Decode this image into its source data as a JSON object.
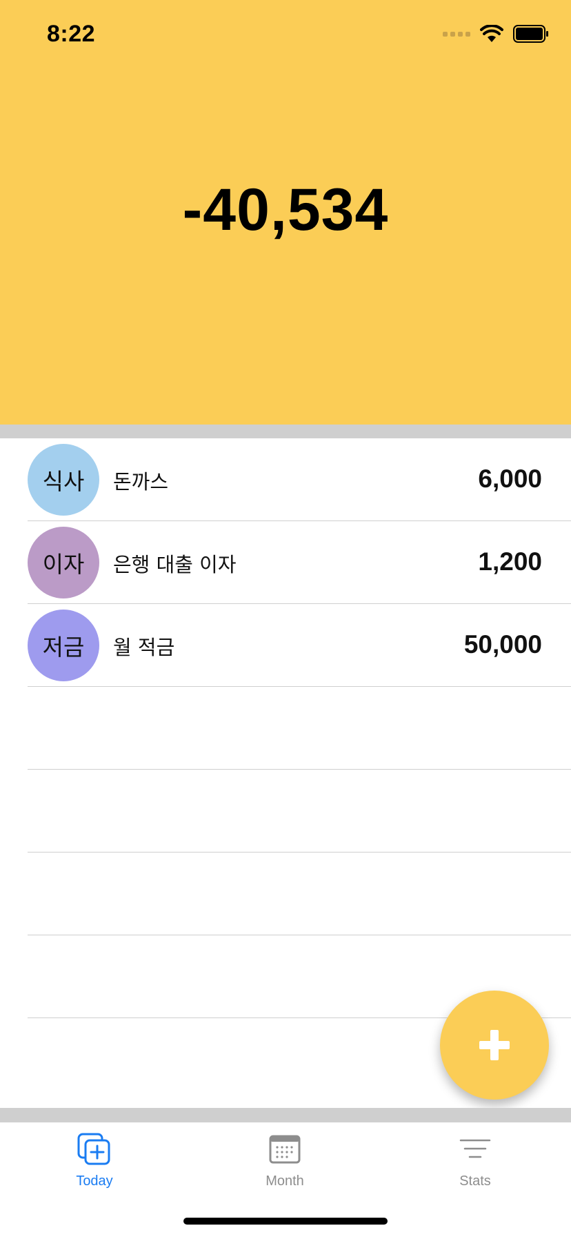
{
  "status_bar": {
    "time": "8:22"
  },
  "summary": {
    "total": "-40,534"
  },
  "entries": [
    {
      "category": "식사",
      "memo": "돈까스",
      "amount": "6,000",
      "color": "#a3cfee"
    },
    {
      "category": "이자",
      "memo": "은행 대출 이자",
      "amount": "1,200",
      "color": "#bb9bc7"
    },
    {
      "category": "저금",
      "memo": "월 적금",
      "amount": "50,000",
      "color": "#9e9bee"
    }
  ],
  "tabs": [
    {
      "label": "Today",
      "icon": "add-square-icon",
      "active": true
    },
    {
      "label": "Month",
      "icon": "calendar-icon",
      "active": false
    },
    {
      "label": "Stats",
      "icon": "lines-icon",
      "active": false
    }
  ],
  "colors": {
    "accent": "#fbcd56",
    "tab_active": "#1a7cf2",
    "tab_inactive": "#8d8d8d"
  }
}
